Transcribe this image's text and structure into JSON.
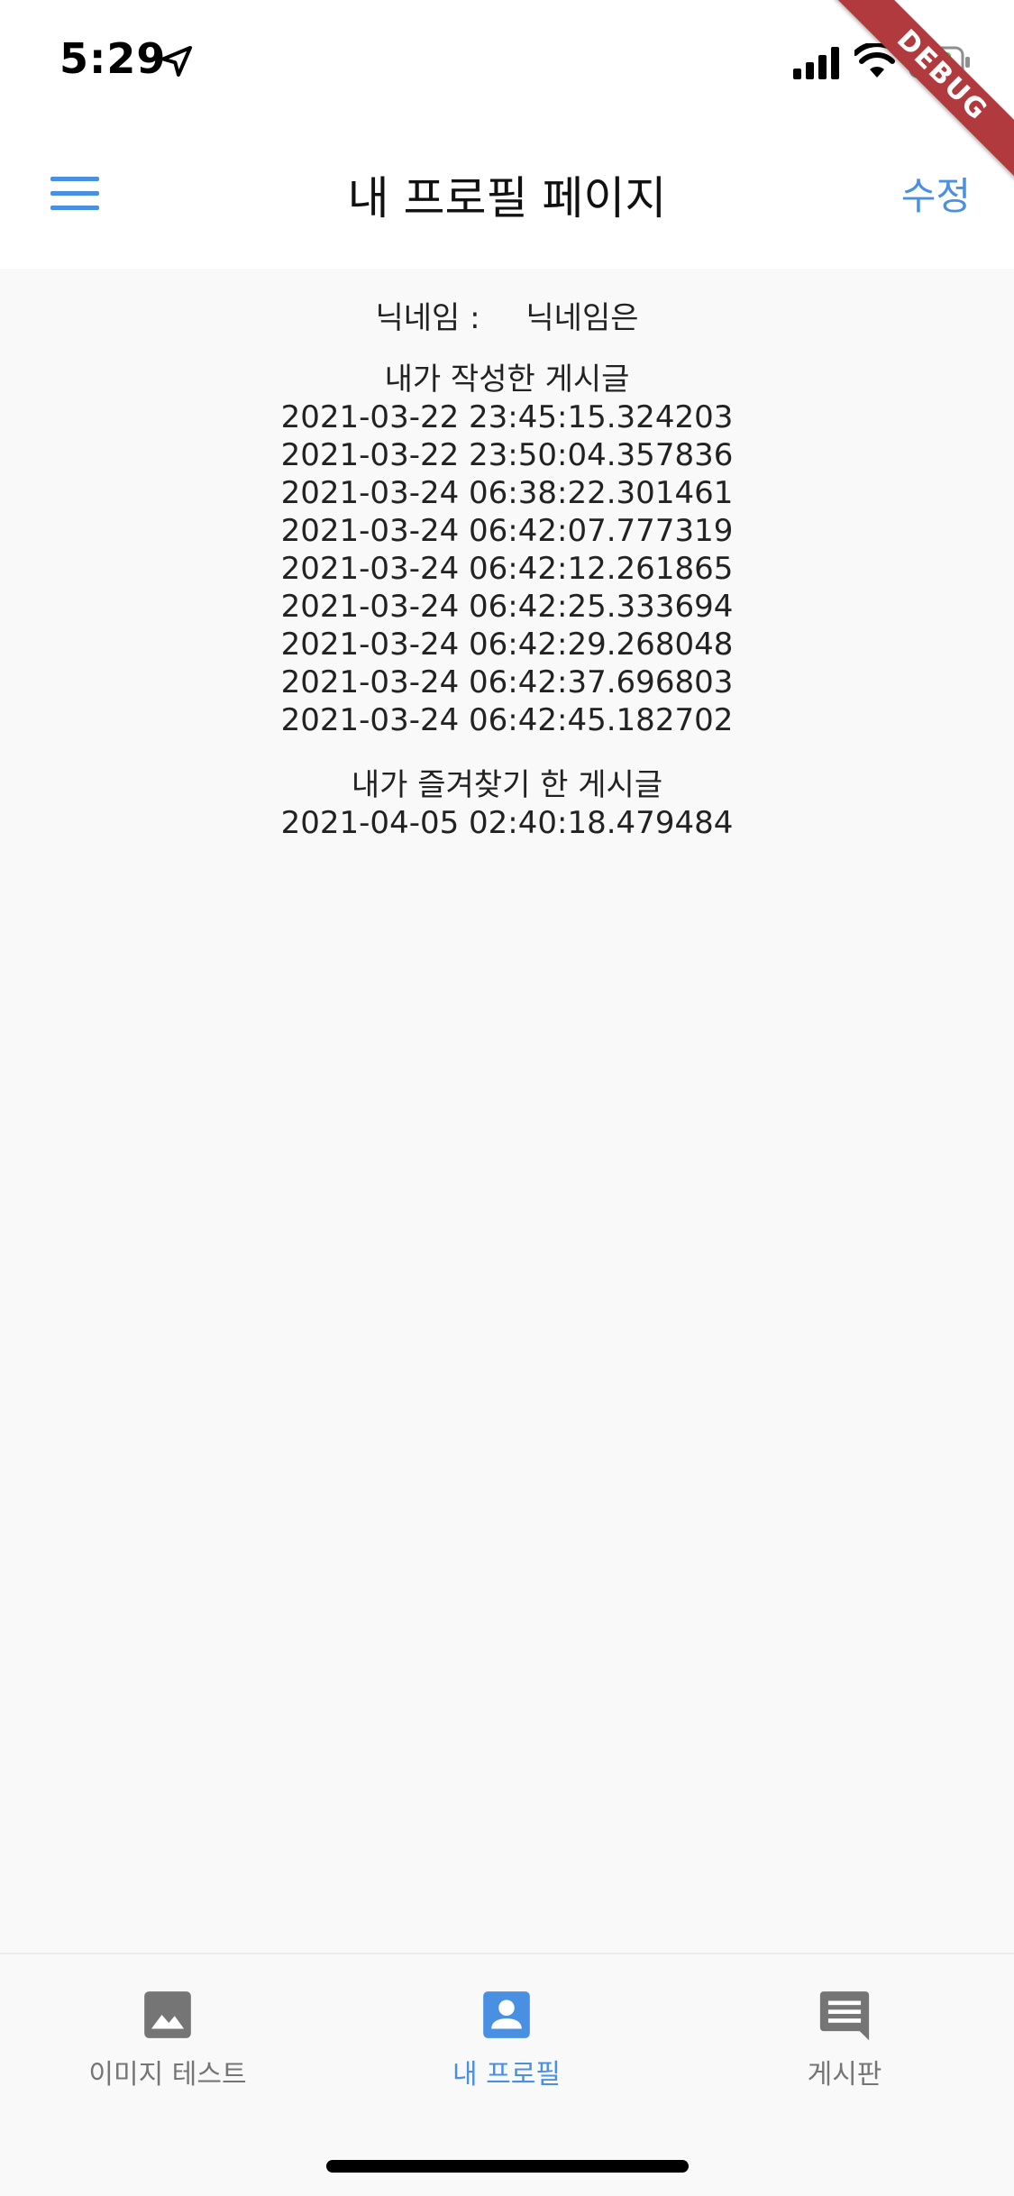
{
  "status_bar": {
    "time": "5:29"
  },
  "debug_banner": "DEBUG",
  "app_bar": {
    "title": "내 프로필 페이지",
    "edit_label": "수정"
  },
  "profile": {
    "nickname_label": "닉네임 :",
    "nickname_value": "닉네임은",
    "my_posts_title": "내가 작성한 게시글",
    "my_posts": [
      "2021-03-22 23:45:15.324203",
      "2021-03-22 23:50:04.357836",
      "2021-03-24 06:38:22.301461",
      "2021-03-24 06:42:07.777319",
      "2021-03-24 06:42:12.261865",
      "2021-03-24 06:42:25.333694",
      "2021-03-24 06:42:29.268048",
      "2021-03-24 06:42:37.696803",
      "2021-03-24 06:42:45.182702"
    ],
    "favorites_title": "내가 즐겨찾기 한 게시글",
    "favorites": [
      "2021-04-05 02:40:18.479484"
    ]
  },
  "bottom_nav": {
    "items": [
      {
        "label": "이미지 테스트",
        "icon": "image-icon"
      },
      {
        "label": "내 프로필",
        "icon": "account-box-icon"
      },
      {
        "label": "게시판",
        "icon": "chat-icon"
      }
    ],
    "active_index": 1
  },
  "colors": {
    "accent": "#4a90e2",
    "inactive": "#757575",
    "debug": "#b03a3e"
  }
}
